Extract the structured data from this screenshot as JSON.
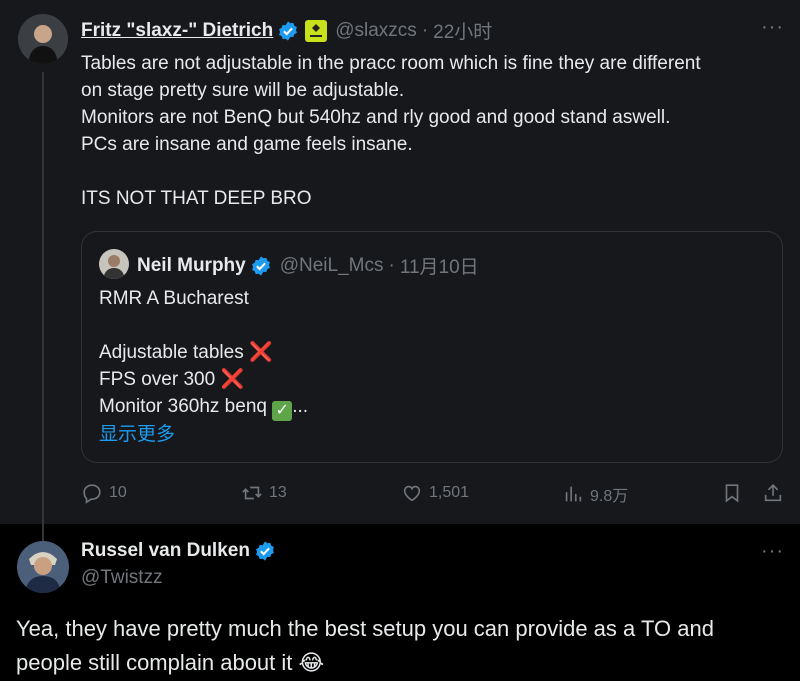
{
  "main_tweet": {
    "author_name": "Fritz \"slaxz-\" Dietrich",
    "handle": "@slaxzcs",
    "separator": "·",
    "time": "22小时",
    "lines": [
      "Tables are not adjustable in the pracc room which is fine they are different",
      "on stage pretty sure will be adjustable.",
      "Monitors are not BenQ but 540hz and rly good and good stand aswell.",
      "PCs are insane and game feels insane.",
      "",
      "ITS NOT THAT DEEP BRO"
    ],
    "more_label": "···"
  },
  "quoted_tweet": {
    "author_name": "Neil Murphy",
    "handle": "@NeiL_Mcs",
    "separator": "·",
    "time": "11月10日",
    "title": "RMR A Bucharest",
    "items": [
      {
        "text": "Adjustable tables",
        "mark": "❌"
      },
      {
        "text": "FPS over 300",
        "mark": "❌"
      },
      {
        "text": "Monitor 360hz benq",
        "mark": "✓",
        "suffix": "..."
      }
    ],
    "show_more": "显示更多"
  },
  "actions": {
    "replies": "10",
    "retweets": "13",
    "likes": "1,501",
    "views": "9.8万"
  },
  "reply_tweet": {
    "author_name": "Russel van Dulken",
    "handle": "@Twistzz",
    "text": "Yea, they have pretty much the best setup you can provide as a TO and people still complain about it",
    "emoji": "😂",
    "more_label": "···"
  },
  "colors": {
    "verified": "#1d9bf0",
    "link": "#1d9bf0",
    "muted": "#71767b",
    "badge": "#c8e11b"
  },
  "icons": [
    "verified-badge-icon",
    "team-badge-icon",
    "reply-icon",
    "retweet-icon",
    "like-icon",
    "views-icon",
    "bookmark-icon",
    "share-icon"
  ]
}
